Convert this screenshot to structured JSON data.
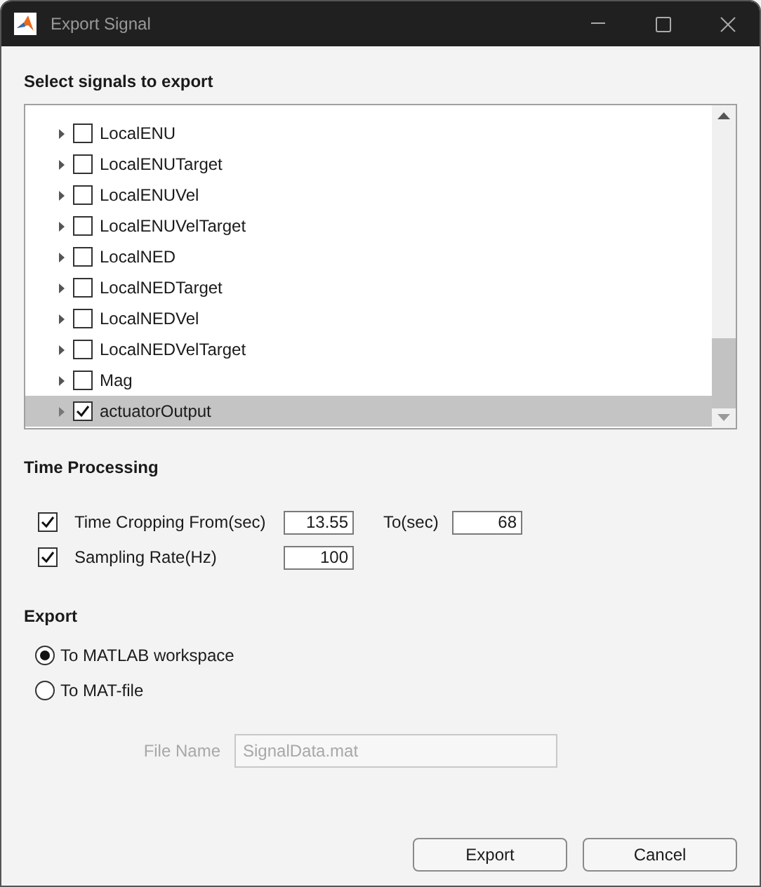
{
  "window": {
    "title": "Export Signal"
  },
  "signals": {
    "heading": "Select signals to export",
    "items": [
      {
        "label": "LocalENU",
        "checked": false,
        "selected": false
      },
      {
        "label": "LocalENUTarget",
        "checked": false,
        "selected": false
      },
      {
        "label": "LocalENUVel",
        "checked": false,
        "selected": false
      },
      {
        "label": "LocalENUVelTarget",
        "checked": false,
        "selected": false
      },
      {
        "label": "LocalNED",
        "checked": false,
        "selected": false
      },
      {
        "label": "LocalNEDTarget",
        "checked": false,
        "selected": false
      },
      {
        "label": "LocalNEDVel",
        "checked": false,
        "selected": false
      },
      {
        "label": "LocalNEDVelTarget",
        "checked": false,
        "selected": false
      },
      {
        "label": "Mag",
        "checked": false,
        "selected": false
      },
      {
        "label": "actuatorOutput",
        "checked": true,
        "selected": true
      }
    ]
  },
  "time_processing": {
    "heading": "Time Processing",
    "cropping": {
      "label": "Time Cropping From(sec)",
      "checked": true,
      "from": "13.55",
      "to_label": "To(sec)",
      "to": "68"
    },
    "sampling": {
      "label": "Sampling Rate(Hz)",
      "checked": true,
      "value": "100"
    }
  },
  "export": {
    "heading": "Export",
    "options": [
      {
        "label": "To MATLAB workspace",
        "selected": true
      },
      {
        "label": "To MAT-file",
        "selected": false
      }
    ],
    "file_name": {
      "label": "File Name",
      "value": "SignalData.mat",
      "disabled": true
    }
  },
  "buttons": [
    "Export",
    "Cancel"
  ]
}
